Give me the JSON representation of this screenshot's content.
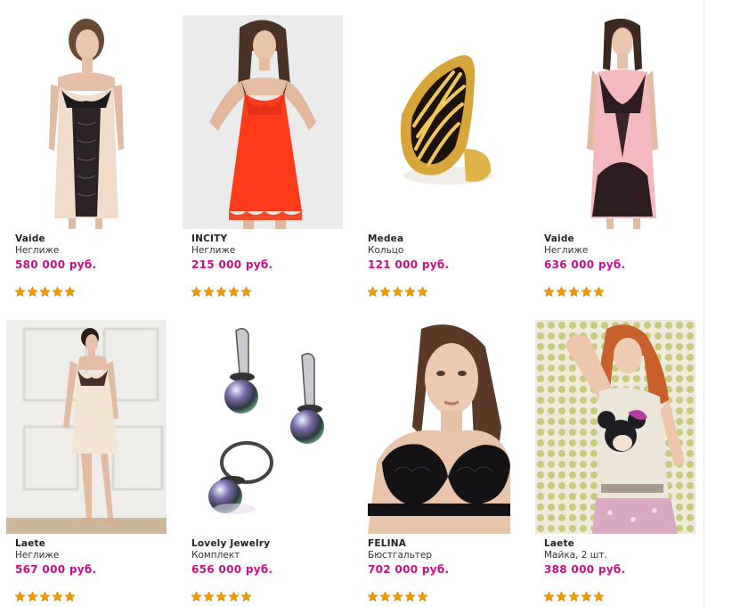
{
  "accent_color": "#cc0c8c",
  "star_color": "#f29a00",
  "products": [
    {
      "brand": "Vaide",
      "category": "Неглиже",
      "price": "580 000 руб.",
      "rating": 5,
      "image": "black-lace-champagne-negligee"
    },
    {
      "brand": "INCITY",
      "category": "Неглиже",
      "price": "215 000 руб.",
      "rating": 5,
      "image": "red-mesh-chemise"
    },
    {
      "brand": "Medea",
      "category": "Кольцо",
      "price": "121 000 руб.",
      "rating": 5,
      "image": "gold-leaf-ring"
    },
    {
      "brand": "Vaide",
      "category": "Неглиже",
      "price": "636 000 руб.",
      "rating": 5,
      "image": "pink-lace-negligee"
    },
    {
      "brand": "Laete",
      "category": "Неглиже",
      "price": "567 000 руб.",
      "rating": 5,
      "image": "cream-negligee-room"
    },
    {
      "brand": "Lovely Jewelry",
      "category": "Комплект",
      "price": "656 000 руб.",
      "rating": 5,
      "image": "pearl-earrings-ring-set"
    },
    {
      "brand": "FELINA",
      "category": "Бюстгальтер",
      "price": "702 000 руб.",
      "rating": 5,
      "image": "black-lace-bra"
    },
    {
      "brand": "Laete",
      "category": "Майка, 2 шт.",
      "price": "388 000 руб.",
      "rating": 5,
      "image": "minnie-print-top"
    }
  ]
}
